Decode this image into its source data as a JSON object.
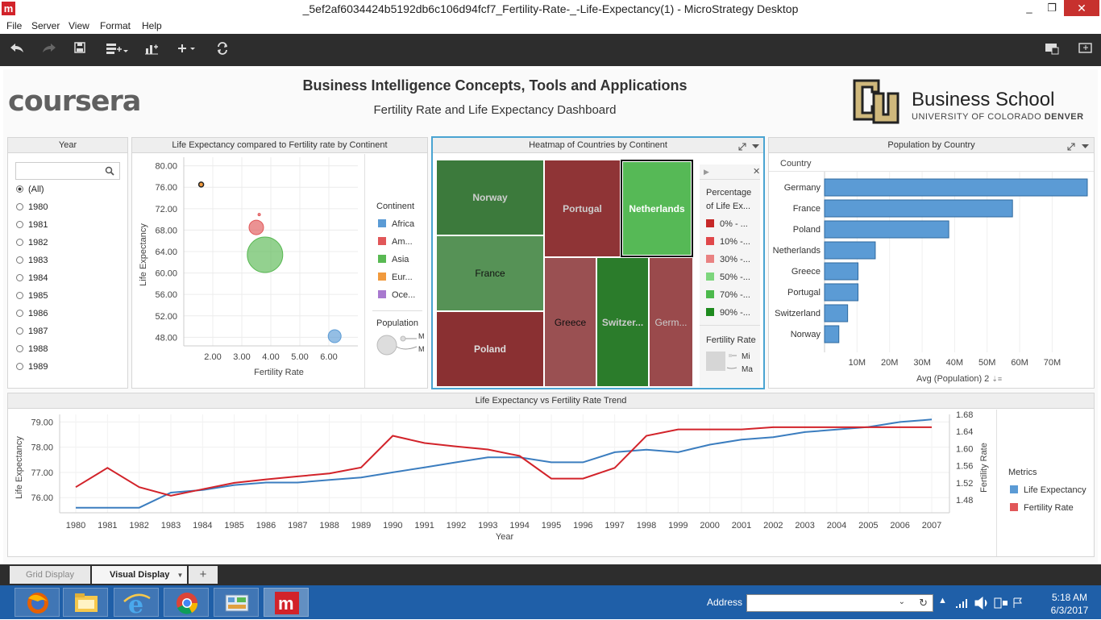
{
  "window": {
    "title": "_5ef2af6034424b5192db6c106d94fcf7_Fertility-Rate-_-Life-Expectancy(1) - MicroStrategy Desktop",
    "app_icon": "m",
    "min": "_",
    "max": "❐",
    "close": "✕"
  },
  "menu": [
    "File",
    "Server",
    "View",
    "Format",
    "Help"
  ],
  "header": {
    "logo": "coursera",
    "title": "Business Intelligence Concepts, Tools and Applications",
    "subtitle": "Fertility Rate and Life Expectancy Dashboard",
    "school": "Business School",
    "university_a": "UNIVERSITY OF COLORADO ",
    "university_b": "DENVER"
  },
  "year_filter": {
    "title": "Year",
    "search_placeholder": "",
    "options": [
      "(All)",
      "1980",
      "1981",
      "1982",
      "1983",
      "1984",
      "1985",
      "1986",
      "1987",
      "1988",
      "1989"
    ],
    "selected": "(All)"
  },
  "bubble_panel": {
    "title": "Life Expectancy compared to Fertility rate by Continent",
    "legend_title": "Continent",
    "legend": [
      {
        "name": "Africa",
        "color": "#5b9bd5"
      },
      {
        "name": "Am...",
        "color": "#e15759"
      },
      {
        "name": "Asia",
        "color": "#59b953"
      },
      {
        "name": "Eur...",
        "color": "#f19a3d"
      },
      {
        "name": "Oce...",
        "color": "#a879cf"
      }
    ],
    "size_legend_title": "Population",
    "size_legend_labels": [
      "M",
      "M"
    ]
  },
  "heatmap_panel": {
    "title": "Heatmap of Countries by Continent",
    "legend_title_1": "Percentage",
    "legend_title_2": "of Life Ex...",
    "legend": [
      {
        "label": "0% - ...",
        "color": "#c62828"
      },
      {
        "label": "10% -...",
        "color": "#e0474a"
      },
      {
        "label": "30% -...",
        "color": "#e98282"
      },
      {
        "label": "50% -...",
        "color": "#7dd67d"
      },
      {
        "label": "70% -...",
        "color": "#4cb94c"
      },
      {
        "label": "90% -...",
        "color": "#1e8a1e"
      }
    ],
    "size_legend_title": "Fertility Rate",
    "size_labels": [
      "Mi",
      "Ma"
    ],
    "cells": [
      {
        "name": "Norway",
        "color": "#3c7a3c"
      },
      {
        "name": "France",
        "color": "#569256"
      },
      {
        "name": "Poland",
        "color": "#8a3032"
      },
      {
        "name": "Portugal",
        "color": "#8f3436"
      },
      {
        "name": "Netherlands",
        "color": "#56b956"
      },
      {
        "name": "Greece",
        "color": "#9a5052"
      },
      {
        "name": "Switzer...",
        "color": "#2b7c2b"
      },
      {
        "name": "Germ...",
        "color": "#9a4a4c"
      }
    ]
  },
  "population_panel": {
    "title": "Population by Country",
    "column_header": "Country",
    "xlabel": "Avg (Population) 2",
    "sort_icon": "⇣≡"
  },
  "trend_panel": {
    "title": "Life Expectancy vs Fertility Rate Trend",
    "legend_title": "Metrics"
  },
  "tabs": [
    {
      "label": "Grid Display"
    },
    {
      "label": "Visual Display",
      "active": true
    },
    {
      "label": "+"
    }
  ],
  "taskbar": {
    "address_label": "Address",
    "time": "5:18 AM",
    "date": "6/3/2017"
  },
  "colors": {
    "toolbar": "#2d2d2d",
    "selected_border": "#4aa4d2",
    "taskbar": "#1f5fa8"
  },
  "chart_data": [
    {
      "type": "scatter",
      "title": "Life Expectancy compared to Fertility rate by Continent",
      "xlabel": "Fertility Rate",
      "ylabel": "Life Expectancy",
      "xticks": [
        "2.00",
        "3.00",
        "4.00",
        "5.00",
        "6.00"
      ],
      "yticks": [
        "80.00",
        "76.00",
        "72.00",
        "68.00",
        "64.00",
        "60.00",
        "56.00",
        "52.00",
        "48.00"
      ],
      "xlim": [
        1.0,
        7.0
      ],
      "ylim": [
        46.4,
        81.6
      ],
      "grid": true,
      "points": [
        {
          "x": 1.6,
          "y": 76.5,
          "series": "Eur...",
          "size": 3
        },
        {
          "x": 3.5,
          "y": 68.5,
          "series": "Am...",
          "size": 9
        },
        {
          "x": 3.6,
          "y": 70.9,
          "series": "Am...",
          "size": 1.5
        },
        {
          "x": 3.8,
          "y": 63.4,
          "series": "Asia",
          "size": 22
        },
        {
          "x": 6.2,
          "y": 48.2,
          "series": "Africa",
          "size": 8
        }
      ]
    },
    {
      "type": "bar",
      "orientation": "horizontal",
      "title": "Population by Country",
      "xlabel": "Avg (Population) 2",
      "categories": [
        "Germany",
        "France",
        "Poland",
        "Netherlands",
        "Greece",
        "Portugal",
        "Switzerland",
        "Norway"
      ],
      "values": [
        80800000,
        57800000,
        38200000,
        15600000,
        10300000,
        10300000,
        7100000,
        4400000
      ],
      "xticks": [
        "10M",
        "20M",
        "30M",
        "40M",
        "50M",
        "60M",
        "70M"
      ],
      "xlim": [
        0,
        80800000
      ],
      "color": "#5b9bd5"
    },
    {
      "type": "line",
      "title": "Life Expectancy vs Fertility Rate Trend",
      "xlabel": "Year",
      "ylabel": "Life Expectancy",
      "y2label": "Fertility Rate",
      "x": [
        "1980",
        "1981",
        "1982",
        "1983",
        "1984",
        "1985",
        "1986",
        "1987",
        "1988",
        "1989",
        "1990",
        "1991",
        "1992",
        "1993",
        "1994",
        "1995",
        "1996",
        "1997",
        "1998",
        "1999",
        "2000",
        "2001",
        "2002",
        "2003",
        "2004",
        "2005",
        "2006",
        "2007"
      ],
      "yticks": [
        "79.00",
        "78.00",
        "77.00",
        "76.00"
      ],
      "y2ticks": [
        "1.68",
        "1.64",
        "1.60",
        "1.56",
        "1.52",
        "1.48"
      ],
      "ylim": [
        75.4,
        79.3
      ],
      "y2lim": [
        1.45,
        1.68
      ],
      "series": [
        {
          "name": "Life Expectancy",
          "axis": "left",
          "color": "#3b7dbf",
          "values": [
            75.6,
            75.6,
            75.6,
            76.2,
            76.3,
            76.5,
            76.6,
            76.6,
            76.7,
            76.8,
            77.0,
            77.2,
            77.4,
            77.6,
            77.6,
            77.4,
            77.4,
            77.8,
            77.9,
            77.8,
            78.1,
            78.3,
            78.4,
            78.6,
            78.7,
            78.8,
            79.0,
            79.1
          ]
        },
        {
          "name": "Fertility Rate",
          "axis": "right",
          "color": "#d2232a",
          "values": [
            1.51,
            1.555,
            1.51,
            1.49,
            1.505,
            1.52,
            1.528,
            1.535,
            1.542,
            1.556,
            1.63,
            1.613,
            1.605,
            1.598,
            1.583,
            1.53,
            1.53,
            1.555,
            1.63,
            1.645,
            1.645,
            1.645,
            1.65,
            1.65,
            1.65,
            1.65,
            1.65,
            1.65
          ]
        }
      ]
    }
  ]
}
